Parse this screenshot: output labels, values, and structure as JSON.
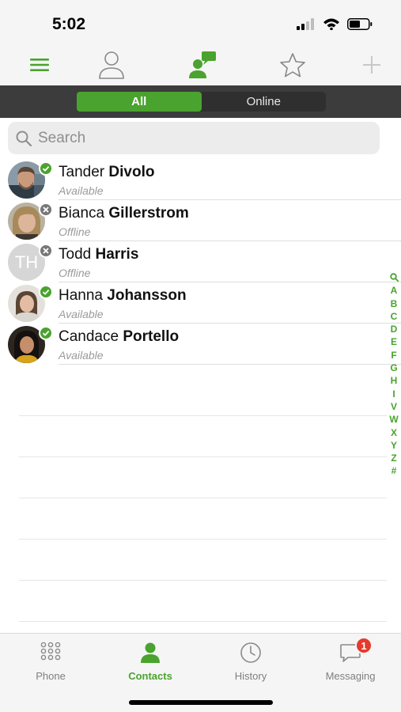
{
  "status_bar": {
    "time": "5:02"
  },
  "segment": {
    "all_label": "All",
    "online_label": "Online"
  },
  "search": {
    "placeholder": "Search"
  },
  "contacts": [
    {
      "first": "Tander",
      "last": "Divolo",
      "status": "Available",
      "presence": "available"
    },
    {
      "first": "Bianca",
      "last": "Gillerstrom",
      "status": "Offline",
      "presence": "offline"
    },
    {
      "first": "Todd",
      "last": "Harris",
      "status": "Offline",
      "presence": "offline",
      "initials": "TH"
    },
    {
      "first": "Hanna",
      "last": "Johansson",
      "status": "Available",
      "presence": "available"
    },
    {
      "first": "Candace",
      "last": "Portello",
      "status": "Available",
      "presence": "available"
    }
  ],
  "index_letters": [
    "A",
    "B",
    "C",
    "D",
    "E",
    "F",
    "G",
    "H",
    "I",
    "V",
    "W",
    "X",
    "Y",
    "Z",
    "#"
  ],
  "tabs": {
    "phone": "Phone",
    "contacts": "Contacts",
    "history": "History",
    "messaging": "Messaging"
  },
  "messaging_badge": "1",
  "colors": {
    "accent": "#49a32e",
    "segment_bg": "#3c3c3c",
    "badge": "#e5392c",
    "offline": "#777777"
  }
}
